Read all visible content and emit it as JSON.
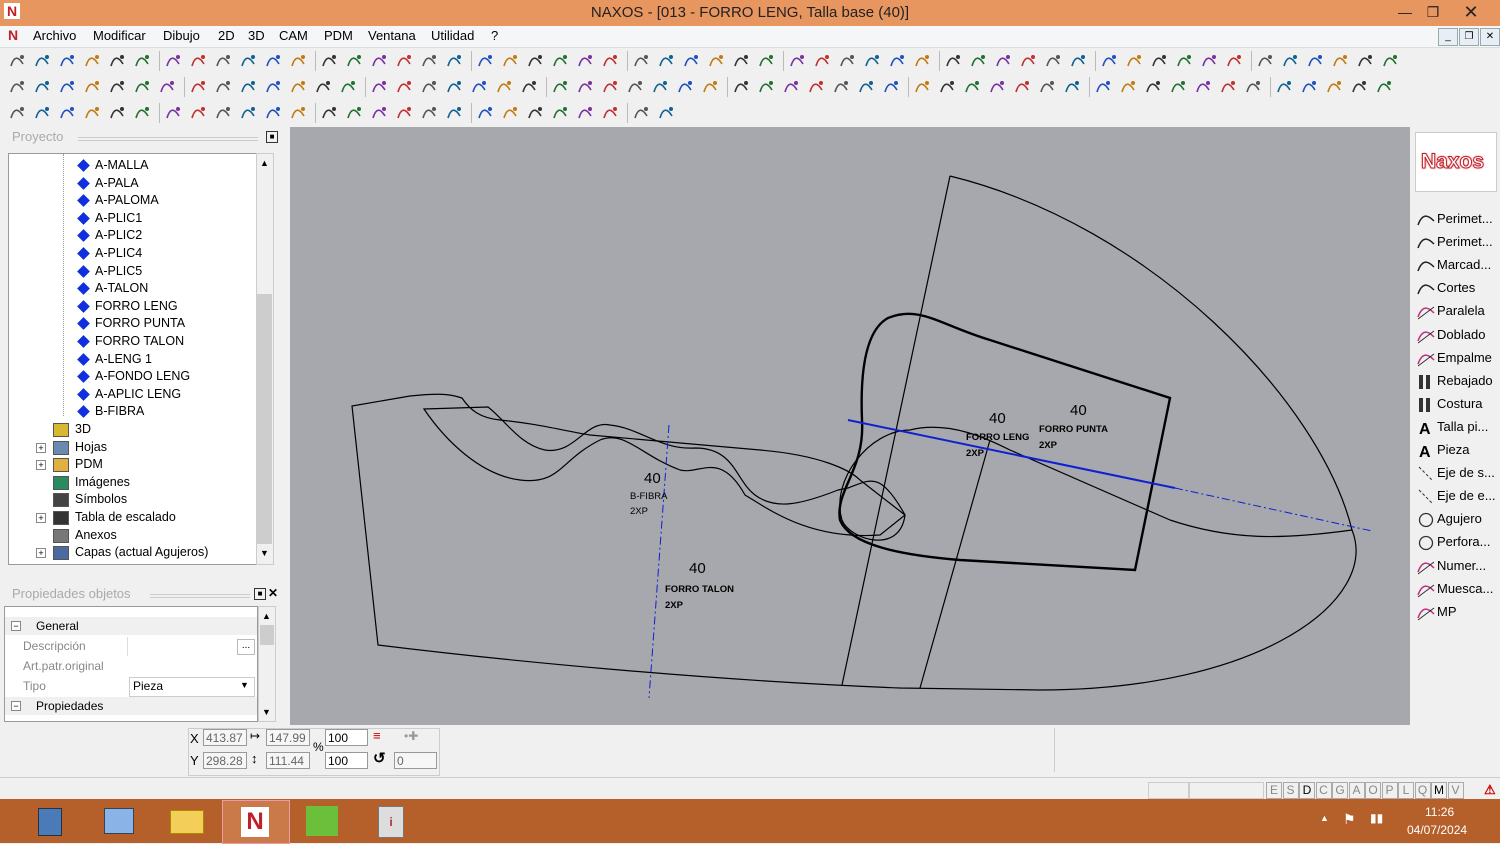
{
  "window": {
    "title": "NAXOS - [013 - FORRO LENG, Talla base (40)]"
  },
  "menu": [
    "Archivo",
    "Modificar",
    "Dibujo",
    "2D",
    "3D",
    "CAM",
    "PDM",
    "Ventana",
    "Utilidad",
    "?"
  ],
  "project_panel": {
    "title": "Proyecto",
    "pieces": [
      "A-MALLA",
      "A-PALA",
      "A-PALOMA",
      "A-PLIC1",
      "A-PLIC2",
      "A-PLIC4",
      "A-PLIC5",
      "A-TALON",
      "FORRO LENG",
      "FORRO PUNTA",
      "FORRO TALON",
      "A-LENG 1",
      "A-FONDO LENG",
      "A-APLIC LENG",
      "B-FIBRA"
    ],
    "folders": [
      "3D",
      "Hojas",
      "PDM",
      "Imágenes",
      "Símbolos",
      "Tabla de escalado",
      "Anexos",
      "Capas (actual Agujeros)"
    ]
  },
  "properties_panel": {
    "title": "Propiedades objetos",
    "general_label": "General",
    "descripcion_label": "Descripción",
    "descripcion_value": "",
    "ellipsis": "...",
    "art_label": "Art.patr.original",
    "tipo_label": "Tipo",
    "tipo_value": "Pieza",
    "propiedades_label": "Propiedades"
  },
  "canvas": {
    "size_labels": [
      "40",
      "40",
      "40",
      "40"
    ],
    "piece_names": [
      "FORRO LENG",
      "FORRO PUNTA",
      "B-FIBRA",
      "FORRO TALON"
    ],
    "qty": "2XP",
    "colors": {
      "background": "#a7a7ae",
      "outline": "#000000",
      "axis": "#1020d0"
    }
  },
  "palette": {
    "brand": "Naxos",
    "items": [
      "Perimet...",
      "Perimet...",
      "Marcad...",
      "Cortes",
      "Paralela",
      "Doblado",
      "Empalme",
      "Rebajado",
      "Costura",
      "Talla pi...",
      "Pieza",
      "Eje de s...",
      "Eje de e...",
      "Agujero",
      "Perfora...",
      "Numer...",
      "Muesca...",
      "MP"
    ]
  },
  "coords": {
    "x_label": "X",
    "x_value": "413.87",
    "width_value": "147.99",
    "scale_x": "100",
    "y_label": "Y",
    "y_value": "298.28",
    "height_value": "111.44",
    "scale_y": "100",
    "rotation": "0",
    "percent": "%"
  },
  "statusbar": {
    "letters": [
      "E",
      "S",
      "D",
      "C",
      "G",
      "A",
      "O",
      "P",
      "L",
      "Q",
      "M",
      "V"
    ]
  },
  "taskbar": {
    "time": "11:26",
    "date": "04/07/2024"
  }
}
